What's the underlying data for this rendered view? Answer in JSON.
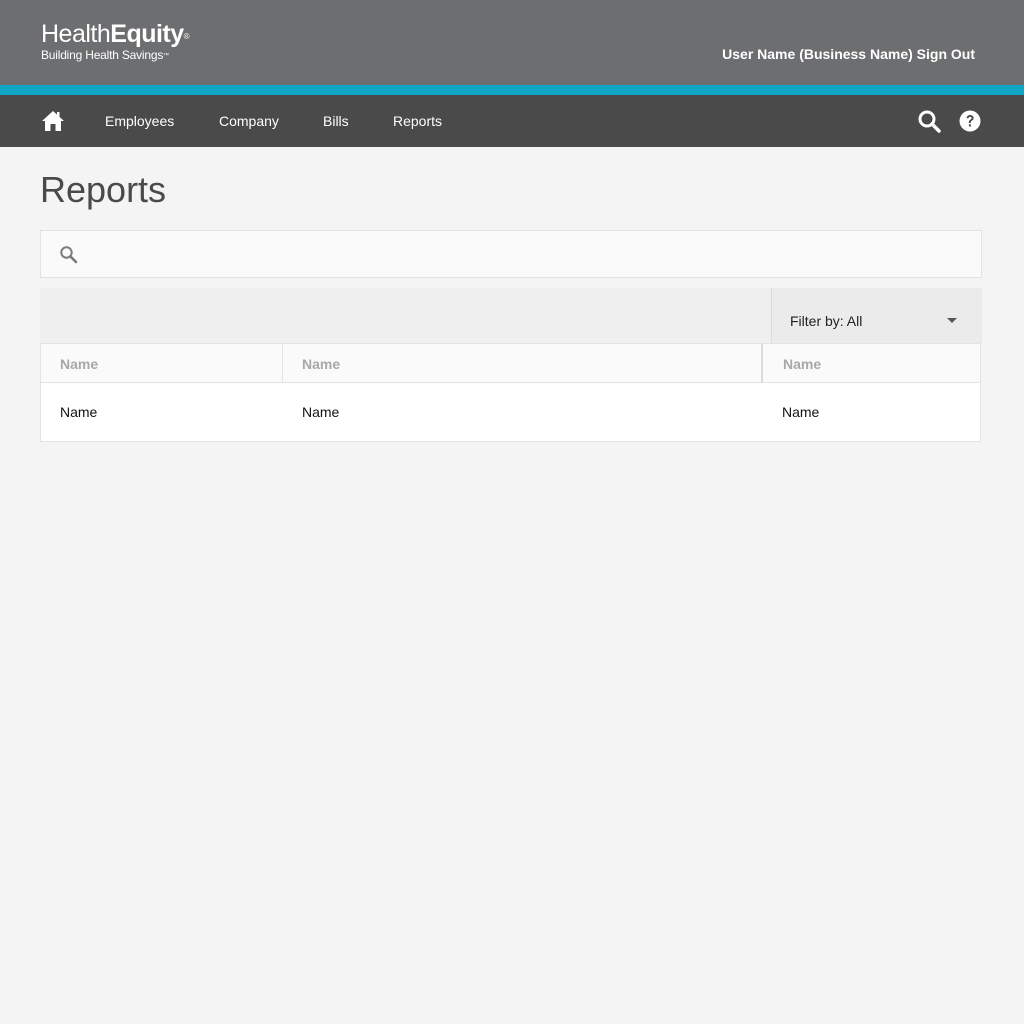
{
  "header": {
    "logo": {
      "word_light": "Health",
      "word_bold": "Equity",
      "registered": "®",
      "tagline": "Building Health Savings",
      "trademark": "™"
    },
    "user_name": "User Name",
    "business_name": "(Business Name)",
    "sign_out_label": "Sign Out"
  },
  "colors": {
    "topbar": "#6d6e70",
    "accent": "#0fa5c5",
    "navbar": "#4a4a4a",
    "background": "#f4f4f4"
  },
  "nav": {
    "home_icon": "home-icon",
    "items": [
      {
        "label": "Employees"
      },
      {
        "label": "Company"
      },
      {
        "label": "Bills"
      },
      {
        "label": "Reports"
      }
    ],
    "search_icon": "search-icon",
    "help_icon": "help-icon"
  },
  "page": {
    "title": "Reports"
  },
  "search": {
    "icon": "search-icon",
    "value": "",
    "placeholder": ""
  },
  "filter": {
    "label": "Filter by: All",
    "icon": "caret-down-icon"
  },
  "table": {
    "columns": [
      "Name",
      "Name",
      "Name"
    ],
    "rows": [
      [
        "Name",
        "Name",
        "Name"
      ]
    ]
  }
}
